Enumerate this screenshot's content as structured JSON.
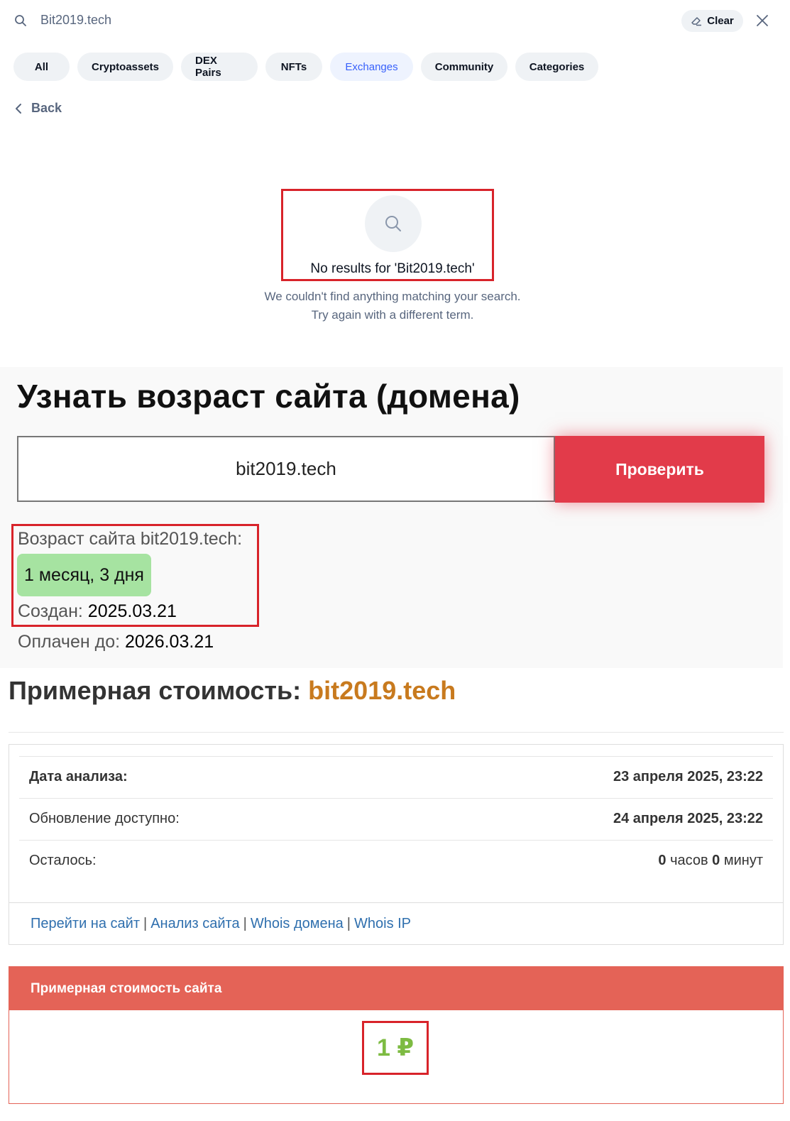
{
  "search": {
    "query": "Bit2019.tech",
    "clear_label": "Clear",
    "tabs": [
      {
        "label": "All"
      },
      {
        "label": "Cryptoassets"
      },
      {
        "label": "DEX Pairs"
      },
      {
        "label": "NFTs"
      },
      {
        "label": "Exchanges",
        "active": true
      },
      {
        "label": "Community"
      },
      {
        "label": "Categories"
      }
    ],
    "back_label": "Back",
    "no_results_title": "No results for 'Bit2019.tech'",
    "no_results_line1": "We couldn't find anything matching your search.",
    "no_results_line2": "Try again with a different term."
  },
  "age_checker": {
    "title": "Узнать возраст сайта (домена)",
    "input_value": "bit2019.tech",
    "button_label": "Проверить",
    "age_label": "Возраст сайта bit2019.tech:",
    "age_value": "1 месяц, 3 дня",
    "created_label": "Создан:",
    "created_value": "2025.03.21",
    "paid_label": "Оплачен до:",
    "paid_value": "2026.03.21"
  },
  "cost": {
    "heading_prefix": "Примерная стоимость:",
    "heading_domain": "bit2019.tech",
    "rows": [
      {
        "label": "Дата анализа:",
        "value": "23 апреля 2025, 23:22"
      },
      {
        "label": "Обновление доступно:",
        "value": "24 апреля 2025, 23:22"
      },
      {
        "label": "Осталось:",
        "hours": "0",
        "hours_unit": "часов",
        "minutes": "0",
        "minutes_unit": "минут"
      }
    ],
    "links": [
      {
        "label": "Перейти на сайт"
      },
      {
        "label": "Анализ сайта"
      },
      {
        "label": "Whois домена"
      },
      {
        "label": "Whois IP"
      }
    ],
    "price_header": "Примерная стоимость сайта",
    "price_value": "1 ₽"
  },
  "colors": {
    "highlight_border": "#d8232a",
    "active_tab": "#3861fb",
    "check_button": "#e23b4a",
    "age_badge": "#a6e3a1",
    "price_header": "#e46357",
    "price_value": "#7dbb42",
    "heading_domain": "#c87a1e",
    "link": "#2f6fae"
  },
  "icons": [
    "search-icon",
    "eraser-icon",
    "close-icon",
    "chevron-left-icon"
  ]
}
